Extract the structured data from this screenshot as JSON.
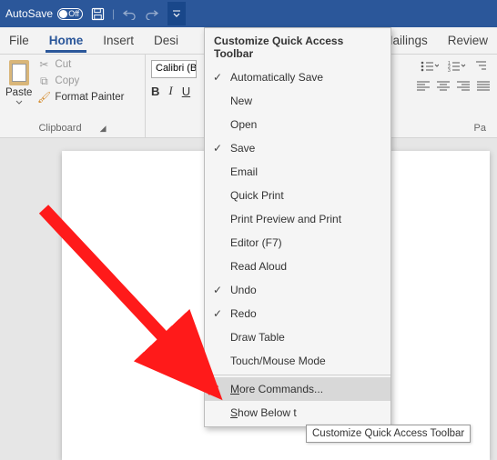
{
  "titlebar": {
    "autosave_label": "AutoSave",
    "autosave_state": "Off"
  },
  "tabs": {
    "file": "File",
    "home": "Home",
    "insert": "Insert",
    "design": "Desi",
    "mailings": "Mailings",
    "review": "Review"
  },
  "clipboard": {
    "paste": "Paste",
    "cut": "Cut",
    "copy": "Copy",
    "format_painter": "Format Painter",
    "group_label": "Clipboard"
  },
  "font": {
    "name": "Calibri (B",
    "bold": "B",
    "italic": "I",
    "underline": "U"
  },
  "paragraph": {
    "right_label": "Pa"
  },
  "menu": {
    "title": "Customize Quick Access Toolbar",
    "items": [
      {
        "label": "Automatically Save",
        "checked": true
      },
      {
        "label": "New",
        "checked": false
      },
      {
        "label": "Open",
        "checked": false
      },
      {
        "label": "Save",
        "checked": true
      },
      {
        "label": "Email",
        "checked": false
      },
      {
        "label": "Quick Print",
        "checked": false
      },
      {
        "label": "Print Preview and Print",
        "checked": false
      },
      {
        "label": "Editor (F7)",
        "checked": false
      },
      {
        "label": "Read Aloud",
        "checked": false
      },
      {
        "label": "Undo",
        "checked": true
      },
      {
        "label": "Redo",
        "checked": true
      },
      {
        "label": "Draw Table",
        "checked": false
      },
      {
        "label": "Touch/Mouse Mode",
        "checked": false
      }
    ],
    "more_commands_pre": "M",
    "more_commands_post": "ore Commands...",
    "show_below_pre": "S",
    "show_below_post": "how Below t"
  },
  "tooltip": "Customize Quick Access Toolbar"
}
